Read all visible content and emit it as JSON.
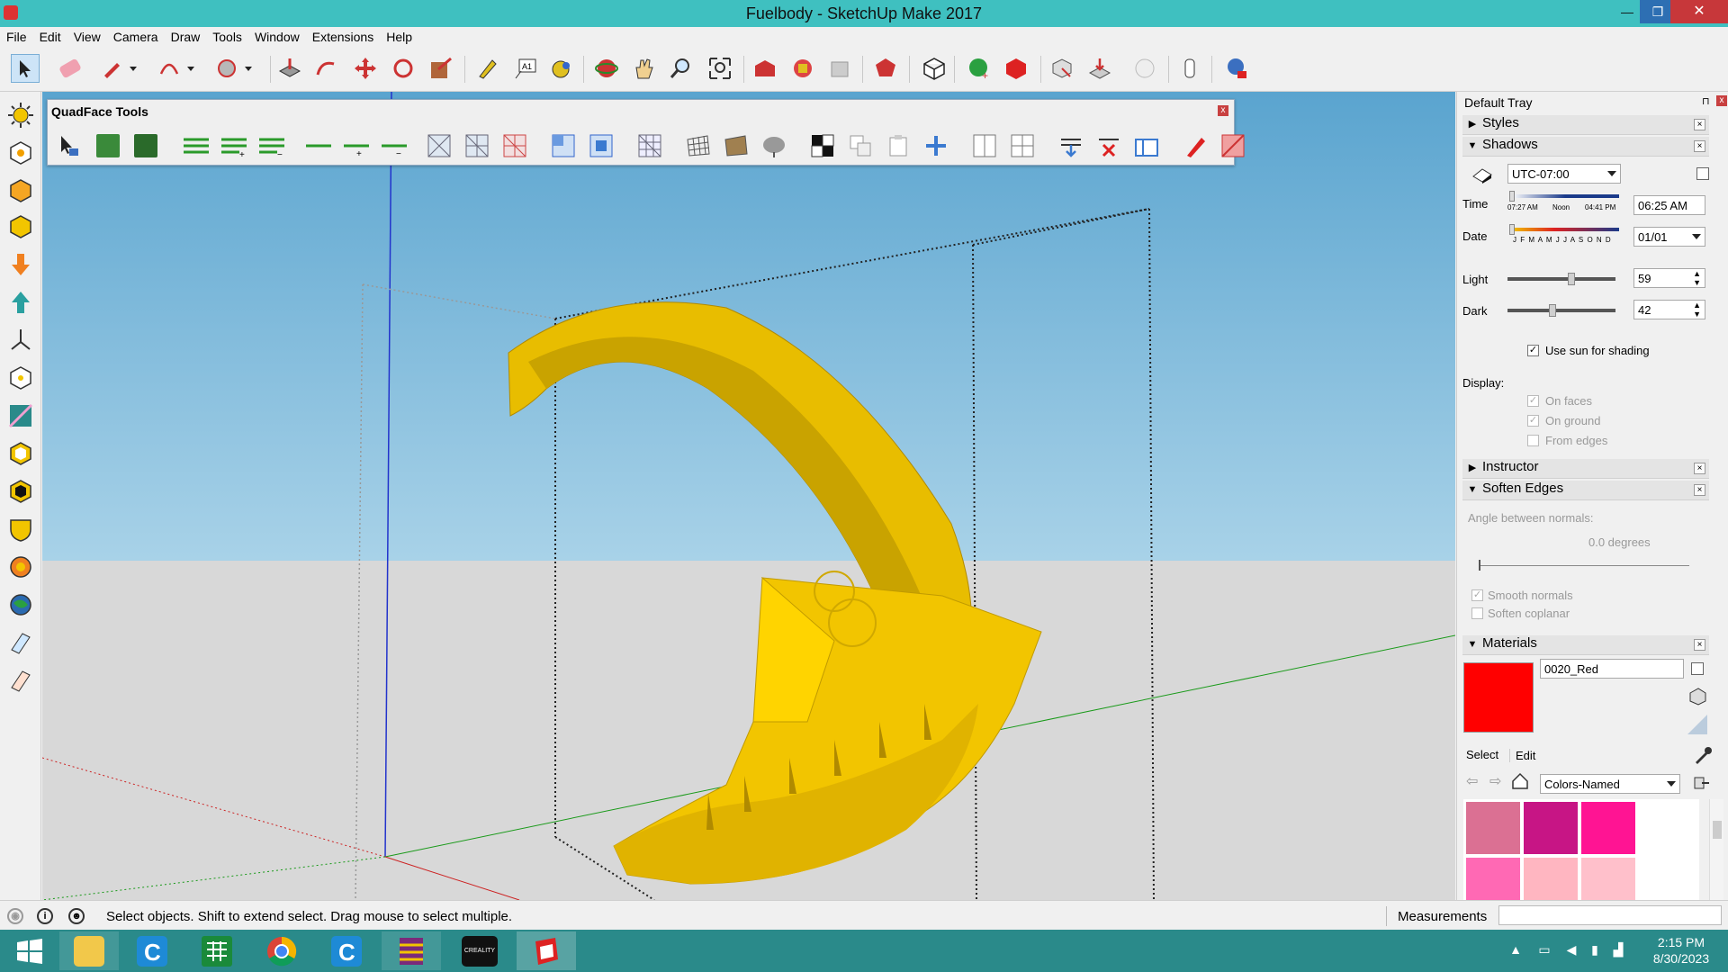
{
  "window": {
    "title": "Fuelbody - SketchUp Make 2017",
    "minimize": "—",
    "maximize": "❐",
    "close": "✕"
  },
  "menu": [
    "File",
    "Edit",
    "View",
    "Camera",
    "Draw",
    "Tools",
    "Window",
    "Extensions",
    "Help"
  ],
  "toolbars": {
    "quadface_title": "QuadFace Tools",
    "quadface_close": "x"
  },
  "tray": {
    "title": "Default Tray",
    "sections": {
      "styles": "Styles",
      "shadows": "Shadows",
      "instructor": "Instructor",
      "soften_edges": "Soften Edges",
      "materials": "Materials"
    },
    "shadows": {
      "timezone": "UTC-07:00",
      "time_label": "Time",
      "time_ticks": [
        "07:27 AM",
        "Noon",
        "04:41 PM"
      ],
      "time_value": "06:25 AM",
      "date_label": "Date",
      "months": "J F M A M J J A S O N D",
      "date_value": "01/01",
      "light_label": "Light",
      "light_value": "59",
      "light_level": 59,
      "dark_label": "Dark",
      "dark_value": "42",
      "dark_level": 42,
      "use_sun": "Use sun for shading",
      "display_label": "Display:",
      "on_faces": "On faces",
      "on_ground": "On ground",
      "from_edges": "From edges"
    },
    "soften": {
      "angle_label": "Angle between normals:",
      "angle_value": "0.0  degrees",
      "smooth_normals": "Smooth normals",
      "soften_coplanar": "Soften coplanar"
    },
    "materials": {
      "name": "0020_Red",
      "current_color": "#ff0000",
      "tab_select": "Select",
      "tab_edit": "Edit",
      "library": "Colors-Named",
      "swatches": [
        "#db7093",
        "#c71585",
        "#ff1493",
        "#ff69b4",
        "#ffb6c1",
        "#ffc0cb"
      ]
    }
  },
  "status": {
    "text": "Select objects. Shift to extend select. Drag mouse to select multiple.",
    "measurements_label": "Measurements"
  },
  "taskbar": {
    "time": "2:15 PM",
    "date": "8/30/2023",
    "creality_label": "CREALITY"
  },
  "colors": {
    "titlebar": "#3fc0c0",
    "taskbar": "#2a8a8a",
    "model": "#f2c500"
  }
}
